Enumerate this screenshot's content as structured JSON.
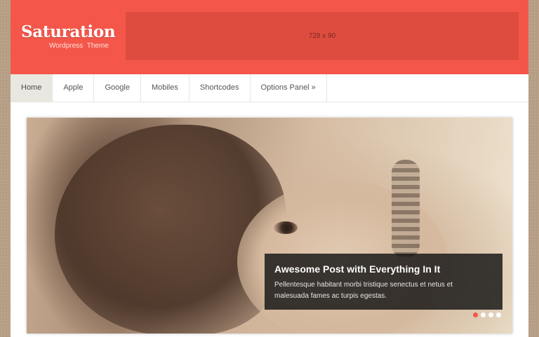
{
  "header": {
    "logo_title": "Saturation",
    "logo_subtitle": "Wordpress  Theme",
    "ad_label": "728 x 90"
  },
  "nav": {
    "items": [
      {
        "label": "Home",
        "active": true
      },
      {
        "label": "Apple"
      },
      {
        "label": "Google"
      },
      {
        "label": "Mobiles"
      },
      {
        "label": "Shortcodes"
      },
      {
        "label": "Options Panel »"
      }
    ]
  },
  "slider": {
    "caption_title": "Awesome Post with Everything In It",
    "caption_text": "Pellentesque habitant morbi tristique senectus et netus et malesuada fames ac turpis egestas.",
    "slide_count": 4,
    "active_slide": 1
  },
  "colors": {
    "brand": "#f4574a",
    "ad_box": "#de4c40",
    "caption_bg": "#141414"
  }
}
